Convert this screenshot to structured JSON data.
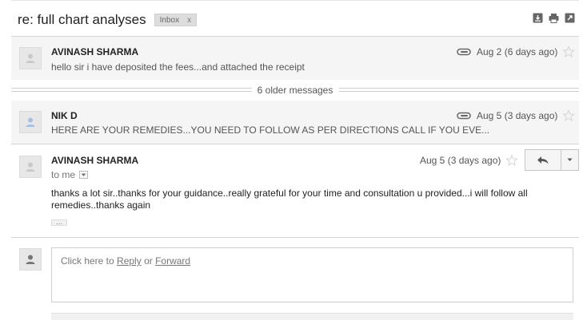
{
  "thread": {
    "subject": "re: full chart analyses",
    "label": "Inbox",
    "label_remove": "x"
  },
  "header_icons": [
    "download-icon",
    "print-icon",
    "new-window-icon"
  ],
  "messages": [
    {
      "sender": "AVINASH SHARMA",
      "snippet": "hello sir i have deposited the fees...and attached the receipt",
      "date": "Aug 2 (6 days ago)",
      "has_attachment": true,
      "starred": false
    },
    {
      "sender": "NIK D",
      "snippet": "HERE ARE YOUR REMEDIES...YOU NEED TO FOLLOW AS PER DIRECTIONS CALL IF YOU EVE...",
      "date": "Aug 5 (3 days ago)",
      "has_attachment": true,
      "starred": false
    },
    {
      "sender": "AVINASH SHARMA",
      "to": "to me",
      "date": "Aug 5 (3 days ago)",
      "body": "thanks a lot sir..thanks for your guidance..really grateful for your time and consultation u provided...i will follow all remedies..thanks again",
      "starred": false
    }
  ],
  "older_messages": "6 older messages",
  "reply": {
    "prefix": "Click here to",
    "reply_link": "Reply",
    "or": "or",
    "forward_link": "Forward"
  },
  "colors": {
    "collapsed_bg": "#f5f5f5",
    "border": "#d4d4d4",
    "label_bg": "#dddddd"
  }
}
